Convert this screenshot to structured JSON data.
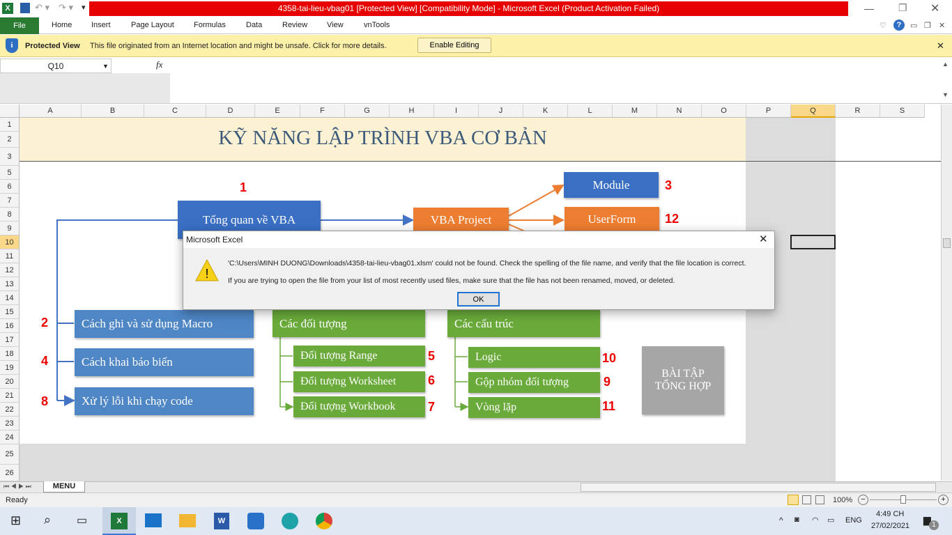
{
  "window": {
    "title": "4358-tai-lieu-vbag01  [Protected View]  [Compatibility Mode]  -  Microsoft Excel (Product Activation Failed)"
  },
  "ribbon": {
    "tabs": [
      "File",
      "Home",
      "Insert",
      "Page Layout",
      "Formulas",
      "Data",
      "Review",
      "View",
      "vnTools"
    ]
  },
  "protected_view": {
    "label": "Protected View",
    "message": "This file originated from an Internet location and might be unsafe. Click for more details.",
    "button": "Enable Editing"
  },
  "formula_bar": {
    "name_box": "Q10",
    "fx": "fx",
    "value": ""
  },
  "columns": [
    "A",
    "B",
    "C",
    "D",
    "E",
    "F",
    "G",
    "H",
    "I",
    "J",
    "K",
    "L",
    "M",
    "N",
    "O",
    "P",
    "Q",
    "R",
    "S"
  ],
  "rows": [
    "1",
    "2",
    "3",
    "5",
    "6",
    "7",
    "8",
    "9",
    "10",
    "11",
    "12",
    "13",
    "14",
    "15",
    "16",
    "17",
    "18",
    "19",
    "20",
    "21",
    "22",
    "23",
    "24",
    "25",
    "26"
  ],
  "sheet": {
    "title": "KỸ NĂNG LẬP TRÌNH VBA CƠ BẢN",
    "boxes": {
      "overview": "Tổng quan về VBA",
      "project": "VBA Project",
      "module": "Module",
      "userform": "UserForm",
      "macro": "Cách ghi  và sử dụng Macro",
      "variables": "Cách khai  báo biến",
      "errors": "Xử lý lỗi khi chạy code",
      "objects": "Các đối tượng",
      "range": "Đối tượng  Range",
      "worksheet": "Đối tượng  Worksheet",
      "workbook": "Đối tượng  Workbook",
      "structures": "Các cấu trúc",
      "logic": "Logic",
      "group": "Gộp nhóm  đối tượng",
      "loop": "Vòng  lặp",
      "exercise": "BÀI  TẬP TỔNG HỢP"
    },
    "numbers": {
      "overview": "1",
      "module": "3",
      "userform": "12",
      "macro": "2",
      "variables": "4",
      "errors": "8",
      "range": "5",
      "worksheet": "6",
      "workbook": "7",
      "logic": "10",
      "group": "9",
      "loop": "11"
    }
  },
  "sheet_tabs": [
    "MENU"
  ],
  "dialog": {
    "title": "Microsoft Excel",
    "line1": "'C:\\Users\\MINH DUONG\\Downloads\\4358-tai-lieu-vbag01.xlsm' could not be found. Check the spelling of the file name, and verify that the file location is correct.",
    "line2": "If you are trying to open the file from your list of most recently used files, make sure that the file has not been renamed, moved, or deleted.",
    "ok": "OK"
  },
  "status": {
    "ready": "Ready",
    "zoom": "100%"
  },
  "taskbar": {
    "lang": "ENG",
    "time": "4:49 CH",
    "date": "27/02/2021",
    "notifications": "1"
  }
}
